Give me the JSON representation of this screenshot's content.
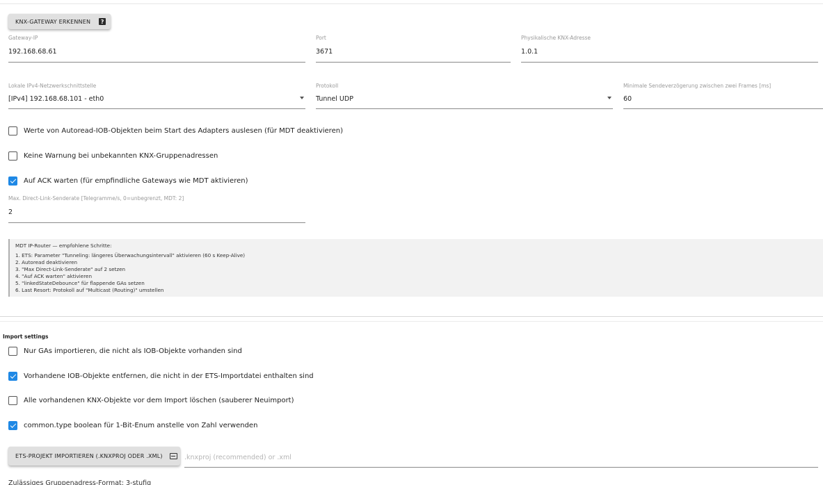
{
  "detect_button": {
    "label": "KNX-Gateway erkennen",
    "help_icon": "?"
  },
  "fields": {
    "gateway_ip": {
      "label": "Gateway-IP",
      "value": "192.168.68.61"
    },
    "port": {
      "label": "Port",
      "value": "3671"
    },
    "phys_address": {
      "label": "Physikalische KNX-Adresse",
      "value": "1.0.1"
    },
    "local_interface": {
      "label": "Lokale IPv4-Netzwerkschnittstelle",
      "value": "[IPv4] 192.168.68.101 - eth0"
    },
    "protocol": {
      "label": "Protokoll",
      "value": "Tunnel UDP"
    },
    "min_delay": {
      "label": "Minimale Sendeverzögerung zwischen zwei Frames [ms]",
      "value": "60"
    },
    "max_rate": {
      "label": "Max. Direct-Link-Senderate [Telegramme/s, 0=unbegrenzt, MDT: 2]",
      "value": "2"
    }
  },
  "options": {
    "autoread": {
      "label": "Werte von Autoread-IOB-Objekten beim Start des Adapters auslesen (für MDT deaktivieren)",
      "checked": false
    },
    "no_warning": {
      "label": "Keine Warnung bei unbekannten KNX-Gruppenadressen",
      "checked": false
    },
    "wait_ack": {
      "label": "Auf ACK warten (für empfindliche Gateways wie MDT aktivieren)",
      "checked": true
    }
  },
  "info": {
    "title": "MDT IP-Router — empfohlene Schritte:",
    "lines": [
      "1. ETS: Parameter \"Tunneling: längeres Überwachungsintervall\" aktivieren (60 s Keep-Alive)",
      "2. Autoread deaktivieren",
      "3. \"Max Direct-Link-Senderate\" auf 2 setzen",
      "4. \"Auf ACK warten\" aktivieren",
      "5. \"linkedStateDebounce\" für flappende GAs setzen",
      "6. Last Resort: Protokoll auf \"Multicast (Routing)\" umstellen"
    ]
  },
  "import": {
    "title": "Import settings",
    "only_missing": {
      "label": "Nur GAs importieren, die nicht als IOB-Objekte vorhanden sind",
      "checked": false
    },
    "remove_existing": {
      "label": "Vorhandene IOB-Objekte entfernen, die nicht in der ETS-Importdatei enthalten sind",
      "checked": true
    },
    "delete_all": {
      "label": "Alle vorhandenen KNX-Objekte vor dem Import löschen (sauberer Neuimport)",
      "checked": false
    },
    "boolean_enum": {
      "label": "common.type boolean für 1-Bit-Enum anstelle von Zahl verwenden",
      "checked": true
    },
    "import_button": "ETS-Projekt importieren (.knxproj oder .xml)",
    "file_placeholder": ".knxproj (recommended) or .xml",
    "bottom_text": "Zulässiges Gruppenadress-Format: 3-stufig"
  },
  "icons": {
    "help": "help-icon",
    "import": "import-icon",
    "dropdown": "caret-down-icon",
    "checkbox": "checkbox-icon"
  },
  "colors": {
    "accent": "#1e88e5",
    "button_bg": "#e0e0e0",
    "info_bg": "#f2f2f2"
  }
}
